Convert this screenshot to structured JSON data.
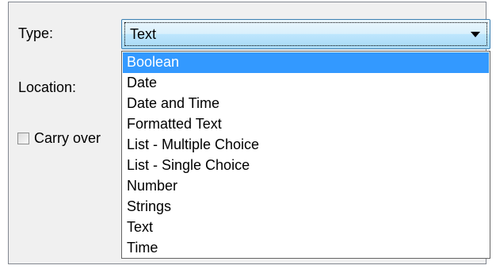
{
  "form": {
    "type_label": "Type:",
    "location_label": "Location:",
    "carry_over_label": "Carry over",
    "carry_over_checked": false
  },
  "type_combo": {
    "value": "Text",
    "arrow_icon": "chevron-down-icon"
  },
  "dropdown": {
    "selected": "Boolean",
    "options": [
      "Boolean",
      "Date",
      "Date and Time",
      "Formatted Text",
      "List - Multiple Choice",
      "List - Single Choice",
      "Number",
      "Strings",
      "Text",
      "Time"
    ]
  }
}
